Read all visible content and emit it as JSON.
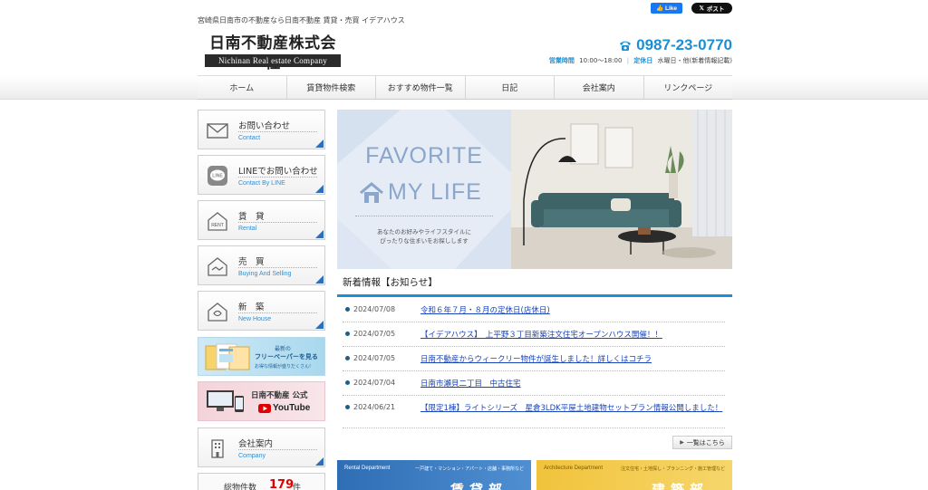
{
  "header": {
    "tagline": "宮崎県日南市の不動産なら日南不動産 賃貸・売買 イデアハウス",
    "social": {
      "facebook_like": "Like",
      "x_post": "ポスト"
    },
    "logo": {
      "jp": "日南不動産株式会社",
      "en": "Nichinan Real estate Company"
    },
    "phone": "0987-23-0770",
    "hours_label": "営業時間",
    "hours_value": "10:00～18:00",
    "holiday_label": "定休日",
    "holiday_value": "水曜日・他(新着情報記載)"
  },
  "nav": {
    "items": [
      {
        "label": "ホーム"
      },
      {
        "label": "賃貸物件検索"
      },
      {
        "label": "おすすめ物件一覧"
      },
      {
        "label": "日記"
      },
      {
        "label": "会社案内"
      },
      {
        "label": "リンクページ"
      }
    ]
  },
  "sidebar": {
    "items": [
      {
        "label": "お問い合わせ",
        "sub": "Contact",
        "icon": "mail-icon"
      },
      {
        "label": "LINEでお問い合わせ",
        "sub": "Contact By LINE",
        "icon": "line-icon"
      },
      {
        "label": "賃　貸",
        "sub": "Rental",
        "icon": "rent-house-icon"
      },
      {
        "label": "売　買",
        "sub": "Buying And Selling",
        "icon": "handshake-house-icon"
      },
      {
        "label": "新　築",
        "sub": "New House",
        "icon": "new-house-icon"
      },
      {
        "label": "会社案内",
        "sub": "Company",
        "icon": "building-icon"
      }
    ],
    "banner_free": {
      "line1": "最新の",
      "line2": "フリーペーパーを見る",
      "line3": "お得な情報が盛りだくさん!"
    },
    "banner_youtube": {
      "line1": "日南不動産 公式",
      "line2": "YouTube"
    },
    "total": {
      "label": "総物件数",
      "count": "179",
      "unit": "件"
    }
  },
  "hero": {
    "title_line1": "FAVORITE",
    "title_line2": "MY LIFE",
    "sub_line1": "あなたのお好みやライフスタイルに",
    "sub_line2": "ぴったりな住まいをお探しします"
  },
  "news": {
    "heading": "新着情報【お知らせ】",
    "items": [
      {
        "date": "2024/07/08",
        "title": "令和６年７月・８月の定休日(店休日)"
      },
      {
        "date": "2024/07/05",
        "title": "【イデアハウス】　上平野３丁目新築注文住宅オープンハウス開催！！"
      },
      {
        "date": "2024/07/05",
        "title": "日南不動産からウィークリー物件が誕生しました！詳しくはコチラ"
      },
      {
        "date": "2024/07/04",
        "title": "日南市瀬貝二丁目　中古住宅"
      },
      {
        "date": "2024/06/21",
        "title": "【限定1棟】ライトシリーズ　星倉3LDK平屋土地建物セットプラン情報公開しました！"
      }
    ],
    "more_label": "一覧はこちら"
  },
  "departments": {
    "rental": {
      "tag": "Rental Department",
      "desc": "一戸建て・マンション・アパート・店舗・事務所など",
      "name": "賃貸部"
    },
    "architecture": {
      "tag": "Architecture Department",
      "desc": "注文住宅・土地探し・プランニング・施工管理など",
      "name": "建築部"
    }
  },
  "colors": {
    "accent": "#1a8fd6",
    "link": "#1a44b8",
    "nav_triangle": "#2d6fb8",
    "total_count": "#e00000"
  }
}
